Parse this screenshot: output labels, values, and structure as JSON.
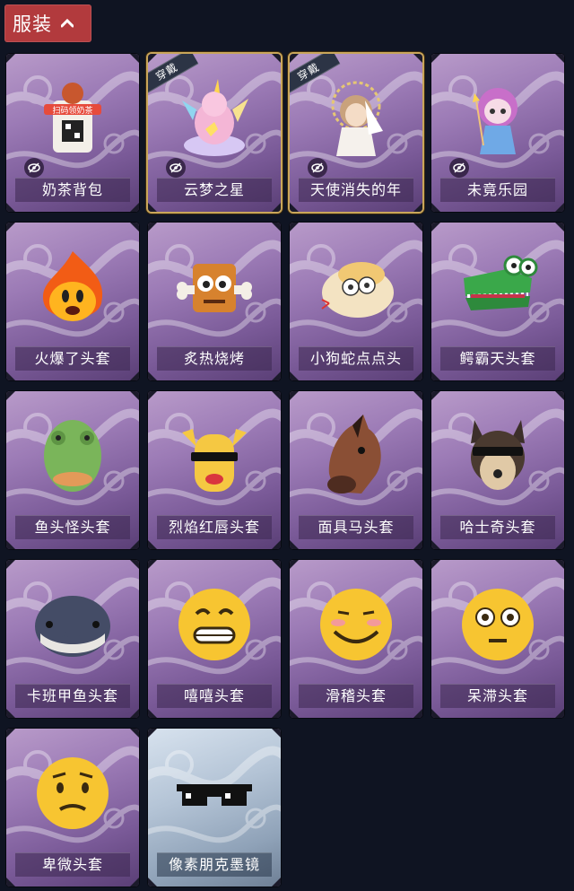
{
  "header": {
    "title": "服装"
  },
  "colors": {
    "accent": "#b23a3d",
    "background": "#0f1422",
    "card_purple": "#9c7bb6",
    "card_blue": "#b4c4d6",
    "worn_border": "#c9a65a"
  },
  "items": [
    {
      "label": "奶茶背包",
      "icon": "milk-tea-backpack",
      "worn": false,
      "hidden_toggle": true,
      "style": "purple",
      "art_text": "扫码领奶茶"
    },
    {
      "label": "云梦之星",
      "icon": "unicorn-cloud",
      "worn": true,
      "badge": "穿戴",
      "hidden_toggle": true,
      "style": "purple"
    },
    {
      "label": "天使消失的年",
      "icon": "angel-doll",
      "worn": true,
      "badge": "穿戴",
      "hidden_toggle": true,
      "style": "purple"
    },
    {
      "label": "未竟乐园",
      "icon": "pink-hair-doll",
      "worn": false,
      "hidden_toggle": true,
      "style": "purple"
    },
    {
      "label": "火爆了头套",
      "icon": "fire-head",
      "worn": false,
      "style": "purple"
    },
    {
      "label": "炙热烧烤",
      "icon": "bbq-meat-head",
      "worn": false,
      "style": "purple"
    },
    {
      "label": "小狗蛇点点头",
      "icon": "snake-head",
      "worn": false,
      "style": "purple"
    },
    {
      "label": "鳄霸天头套",
      "icon": "crocodile-head",
      "worn": false,
      "style": "purple"
    },
    {
      "label": "鱼头怪头套",
      "icon": "fish-head",
      "worn": false,
      "style": "purple"
    },
    {
      "label": "烈焰红唇头套",
      "icon": "yellow-mask-head",
      "worn": false,
      "style": "purple"
    },
    {
      "label": "面具马头套",
      "icon": "horse-head",
      "worn": false,
      "style": "purple"
    },
    {
      "label": "哈士奇头套",
      "icon": "husky-head",
      "worn": false,
      "style": "purple"
    },
    {
      "label": "卡班甲鱼头套",
      "icon": "armored-fish-head",
      "worn": false,
      "style": "purple"
    },
    {
      "label": "嘻嘻头套",
      "icon": "grin-emoji-head",
      "worn": false,
      "style": "purple"
    },
    {
      "label": "滑稽头套",
      "icon": "smirk-emoji-head",
      "worn": false,
      "style": "purple"
    },
    {
      "label": "呆滞头套",
      "icon": "stare-emoji-head",
      "worn": false,
      "style": "purple"
    },
    {
      "label": "卑微头套",
      "icon": "humble-emoji-head",
      "worn": false,
      "style": "purple"
    },
    {
      "label": "像素朋克墨镜",
      "icon": "pixel-sunglasses",
      "worn": false,
      "style": "blue"
    }
  ]
}
